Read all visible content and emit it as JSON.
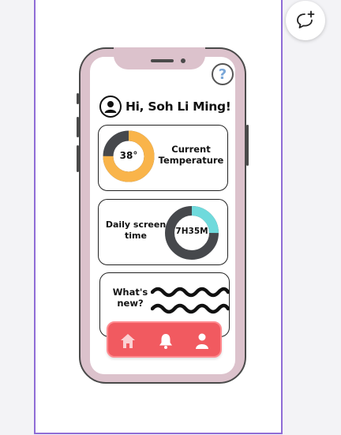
{
  "help": {
    "icon": "question-mark-icon",
    "label": "?"
  },
  "header": {
    "greeting": "Hi, Soh Li Ming!",
    "avatar_icon": "user-avatar-icon"
  },
  "cards": {
    "temperature": {
      "value": "38°",
      "label_line1": "Current",
      "label_line2": "Temperature",
      "fill_fraction": 0.75,
      "fill_color": "#f9b44a",
      "track_color": "#46484c"
    },
    "screen_time": {
      "value": "7H35M",
      "label_line1": "Daily screen",
      "label_line2": "time",
      "fill_fraction": 0.25,
      "fill_color": "#6fdadc",
      "track_color": "#46484c"
    },
    "news": {
      "label_line1": "What's",
      "label_line2": "new?"
    }
  },
  "nav": {
    "items": [
      {
        "name": "home",
        "icon": "home-icon"
      },
      {
        "name": "notifications",
        "icon": "bell-icon"
      },
      {
        "name": "profile",
        "icon": "person-icon"
      }
    ],
    "color": "#f15a60"
  },
  "toolbar": {
    "comment_icon": "add-comment-icon"
  },
  "colors": {
    "frame": "#dcc2cc",
    "page_border": "#8f6cd6"
  }
}
